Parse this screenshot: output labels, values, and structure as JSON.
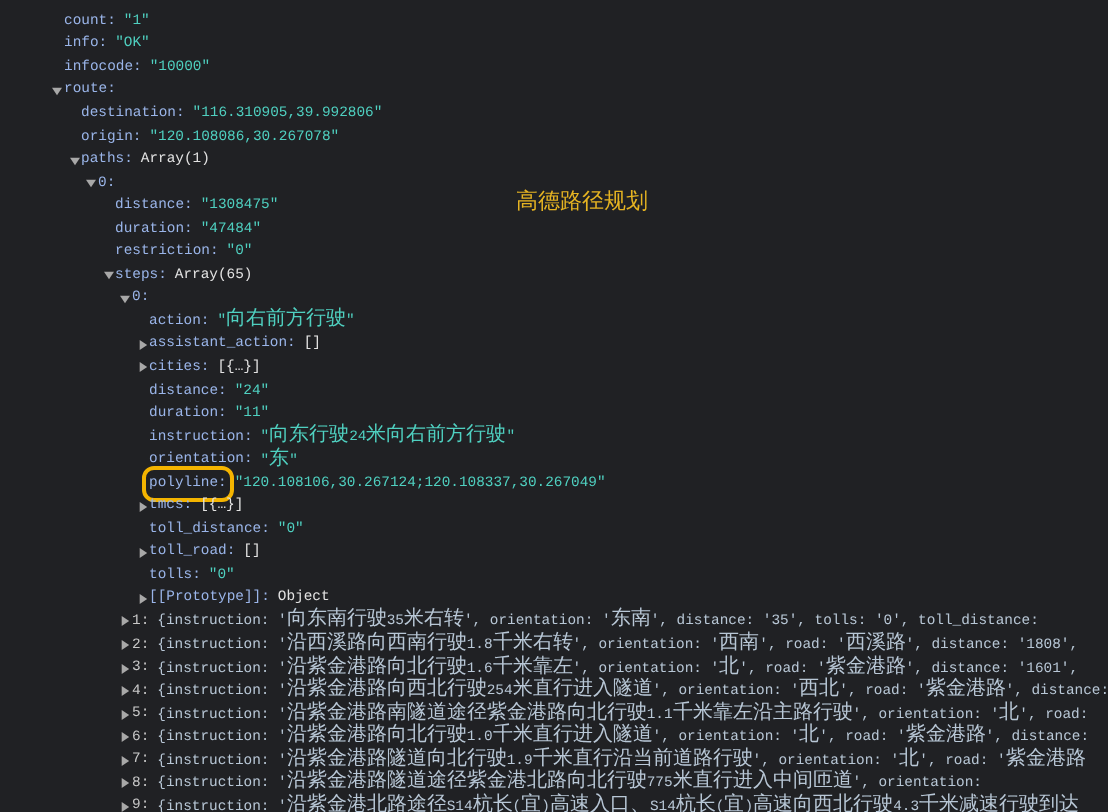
{
  "annotation": {
    "text": "高德路径规划"
  },
  "tree": [
    {
      "key": "count:",
      "value": "\"1\"",
      "kind": "string"
    },
    {
      "key": "info:",
      "value": "\"OK\"",
      "kind": "string"
    },
    {
      "key": "infocode:",
      "value": "\"10000\"",
      "kind": "string"
    },
    {
      "key": "route:",
      "expanded": true,
      "children": [
        {
          "key": "destination:",
          "value": "\"116.310905,39.992806\"",
          "kind": "string"
        },
        {
          "key": "origin:",
          "value": "\"120.108086,30.267078\"",
          "kind": "string"
        },
        {
          "key": "paths:",
          "value": "Array(1)",
          "kind": "plain",
          "expanded": true,
          "children": [
            {
              "key": "0:",
              "expanded": true,
              "children": [
                {
                  "key": "distance:",
                  "value": "\"1308475\"",
                  "kind": "string"
                },
                {
                  "key": "duration:",
                  "value": "\"47484\"",
                  "kind": "string"
                },
                {
                  "key": "restriction:",
                  "value": "\"0\"",
                  "kind": "string"
                },
                {
                  "key": "steps:",
                  "value": "Array(65)",
                  "kind": "plain",
                  "expanded": true,
                  "children": [
                    {
                      "key": "0:",
                      "expanded": true,
                      "children": [
                        {
                          "key": "action:",
                          "value": "\"向右前方行驶\"",
                          "kind": "string"
                        },
                        {
                          "key": "assistant_action:",
                          "value": "[]",
                          "kind": "plain",
                          "expanded": false
                        },
                        {
                          "key": "cities:",
                          "value": "[{…}]",
                          "kind": "plain",
                          "expanded": false
                        },
                        {
                          "key": "distance:",
                          "value": "\"24\"",
                          "kind": "string"
                        },
                        {
                          "key": "duration:",
                          "value": "\"11\"",
                          "kind": "string"
                        },
                        {
                          "key": "instruction:",
                          "value": "\"向东行驶24米向右前方行驶\"",
                          "kind": "string"
                        },
                        {
                          "key": "orientation:",
                          "value": "\"东\"",
                          "kind": "string"
                        },
                        {
                          "key": "polyline:",
                          "value": "\"120.108106,30.267124;120.108337,30.267049\"",
                          "kind": "string",
                          "highlighted": true
                        },
                        {
                          "key": "tmcs:",
                          "value": "[{…}]",
                          "kind": "plain",
                          "expanded": false
                        },
                        {
                          "key": "toll_distance:",
                          "value": "\"0\"",
                          "kind": "string"
                        },
                        {
                          "key": "toll_road:",
                          "value": "[]",
                          "kind": "plain",
                          "expanded": false
                        },
                        {
                          "key": "tolls:",
                          "value": "\"0\"",
                          "kind": "string"
                        },
                        {
                          "key": "[[Prototype]]:",
                          "value": "Object",
                          "kind": "plain",
                          "expanded": false
                        }
                      ]
                    },
                    {
                      "key": "1:",
                      "value": "{instruction: '向东南行驶35米右转', orientation: '东南', distance: '35', tolls: '0', toll_distance:",
                      "kind": "summary",
                      "expanded": false
                    },
                    {
                      "key": "2:",
                      "value": "{instruction: '沿西溪路向西南行驶1.8千米右转', orientation: '西南', road: '西溪路', distance: '1808',",
                      "kind": "summary",
                      "expanded": false
                    },
                    {
                      "key": "3:",
                      "value": "{instruction: '沿紫金港路向北行驶1.6千米靠左', orientation: '北', road: '紫金港路', distance: '1601',",
                      "kind": "summary",
                      "expanded": false
                    },
                    {
                      "key": "4:",
                      "value": "{instruction: '沿紫金港路向西北行驶254米直行进入隧道', orientation: '西北', road: '紫金港路', distance:",
                      "kind": "summary",
                      "expanded": false
                    },
                    {
                      "key": "5:",
                      "value": "{instruction: '沿紫金港路南隧道途径紫金港路向北行驶1.1千米靠左沿主路行驶', orientation: '北', road:",
                      "kind": "summary",
                      "expanded": false
                    },
                    {
                      "key": "6:",
                      "value": "{instruction: '沿紫金港路向北行驶1.0千米直行进入隧道', orientation: '北', road: '紫金港路', distance:",
                      "kind": "summary",
                      "expanded": false
                    },
                    {
                      "key": "7:",
                      "value": "{instruction: '沿紫金港路隧道向北行驶1.9千米直行沿当前道路行驶', orientation: '北', road: '紫金港路",
                      "kind": "summary",
                      "expanded": false
                    },
                    {
                      "key": "8:",
                      "value": "{instruction: '沿紫金港路隧道途径紫金港北路向北行驶775米直行进入中间匝道', orientation:",
                      "kind": "summary",
                      "expanded": false
                    },
                    {
                      "key": "9:",
                      "value": "{instruction: '沿紫金港北路途径S14杭长(宜)高速入口、S14杭长(宜)高速向西北行驶4.3千米减速行驶到达",
                      "kind": "summary",
                      "expanded": false
                    }
                  ]
                }
              ]
            }
          ]
        }
      ]
    }
  ]
}
